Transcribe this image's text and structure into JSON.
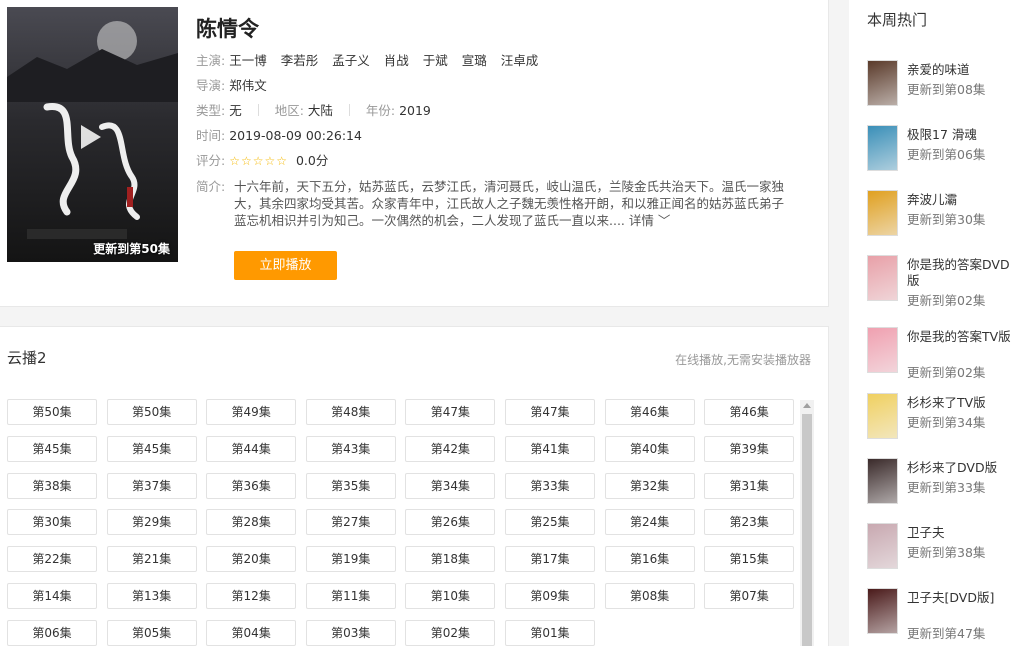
{
  "detail": {
    "title": "陈情令",
    "poster_badge": "更新到第50集",
    "cast_label": "主演:",
    "cast": [
      "王一博",
      "李若彤",
      "孟子义",
      "肖战",
      "于斌",
      "宣璐",
      "汪卓成"
    ],
    "director_label": "导演:",
    "director": "郑伟文",
    "type_label": "类型:",
    "type": "无",
    "region_label": "地区:",
    "region": "大陆",
    "year_label": "年份:",
    "year": "2019",
    "time_label": "时间:",
    "time": "2019-08-09 00:26:14",
    "rating_label": "评分:",
    "rating_stars": "☆☆☆☆☆",
    "rating": "0.0分",
    "summary_label": "简介:",
    "summary": "十六年前，天下五分，姑苏蓝氏，云梦江氏，清河聂氏，岐山温氏，兰陵金氏共治天下。温氏一家独大，其余四家均受其苦。众家青年中，江氏故人之子魏无羡性格开朗，和以雅正闻名的姑苏蓝氏弟子蓝忘机相识并引为知己。一次偶然的机会，二人发现了蓝氏一直以来....",
    "more_label": "详情",
    "play_button": "立即播放"
  },
  "play_source": {
    "name": "云播2",
    "tip": "在线播放,无需安装播放器",
    "episodes": [
      "第50集",
      "第50集",
      "第49集",
      "第48集",
      "第47集",
      "第47集",
      "第46集",
      "第46集",
      "第45集",
      "第45集",
      "第44集",
      "第43集",
      "第42集",
      "第41集",
      "第40集",
      "第39集",
      "第38集",
      "第37集",
      "第36集",
      "第35集",
      "第34集",
      "第33集",
      "第32集",
      "第31集",
      "第30集",
      "第29集",
      "第28集",
      "第27集",
      "第26集",
      "第25集",
      "第24集",
      "第23集",
      "第22集",
      "第21集",
      "第20集",
      "第19集",
      "第18集",
      "第17集",
      "第16集",
      "第15集",
      "第14集",
      "第13集",
      "第12集",
      "第11集",
      "第10集",
      "第09集",
      "第08集",
      "第07集",
      "第06集",
      "第05集",
      "第04集",
      "第03集",
      "第02集",
      "第01集"
    ]
  },
  "sidebar": {
    "title": "本周热门",
    "items": [
      {
        "name": "亲爱的味道",
        "sub": "更新到第08集",
        "color": "#5a3a2a"
      },
      {
        "name": "极限17 滑魂",
        "sub": "更新到第06集",
        "color": "#3a8fb8"
      },
      {
        "name": "奔波儿灞",
        "sub": "更新到第30集",
        "color": "#e0a020"
      },
      {
        "name": "你是我的答案DVD版",
        "sub": "更新到第02集",
        "color": "#e8a0a8"
      },
      {
        "name": "你是我的答案TV版",
        "sub": "更新到第02集",
        "color": "#f0a0b0"
      },
      {
        "name": "杉杉来了TV版",
        "sub": "更新到第34集",
        "color": "#f0d060"
      },
      {
        "name": "杉杉来了DVD版",
        "sub": "更新到第33集",
        "color": "#3a2a2a"
      },
      {
        "name": "卫子夫",
        "sub": "更新到第38集",
        "color": "#c8a8b0"
      },
      {
        "name": "卫子夫[DVD版]",
        "sub": "更新到第47集",
        "color": "#4a1a1a"
      }
    ]
  }
}
